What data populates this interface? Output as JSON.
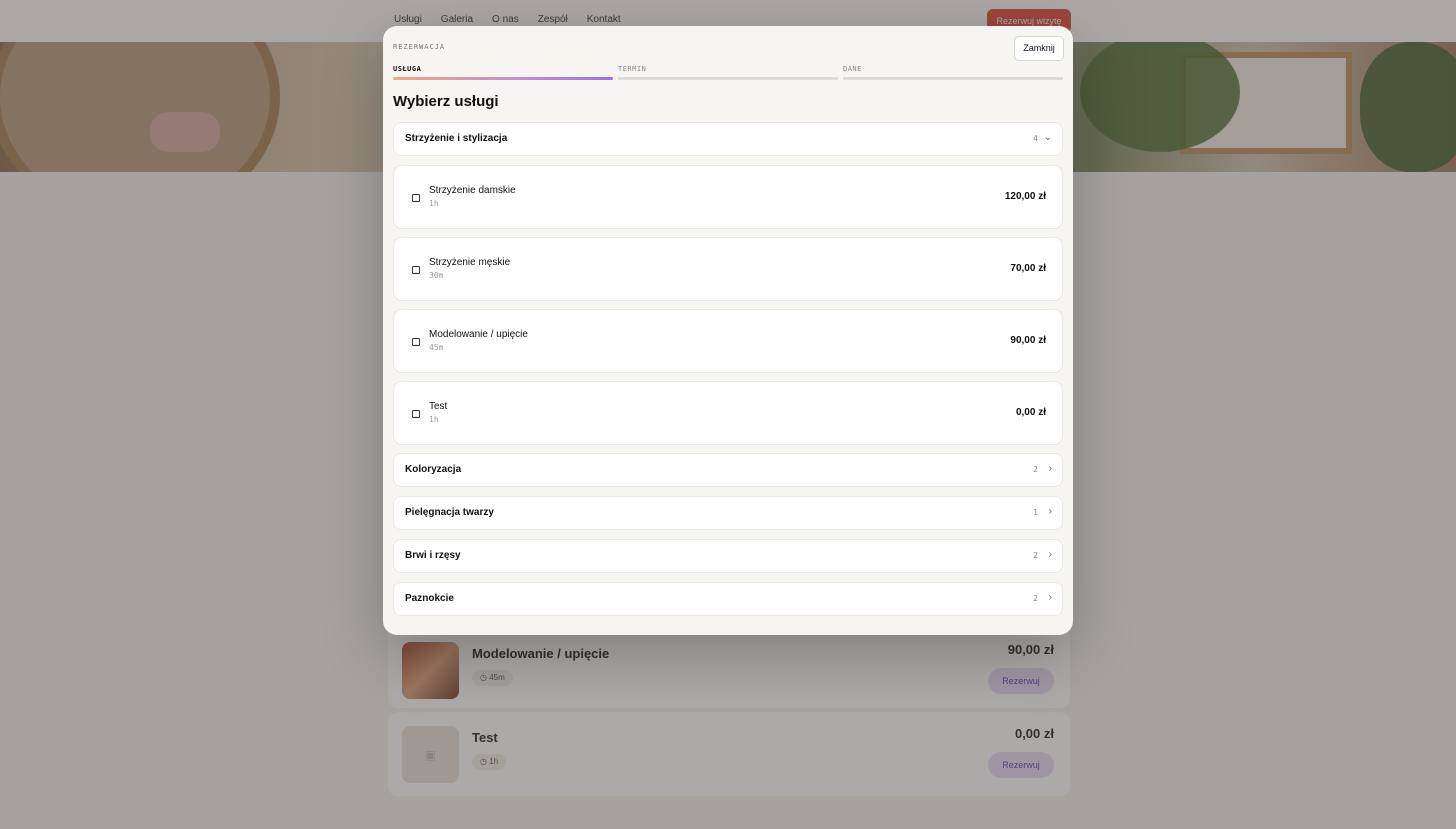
{
  "nav": {
    "links": [
      "Usługi",
      "Galeria",
      "O nas",
      "Zespół",
      "Kontakt"
    ],
    "cta": "Rezerwuj wizytę"
  },
  "background_cards": [
    {
      "title": "Modelowanie / upięcie",
      "duration": "45m",
      "price": "90,00 zł",
      "button": "Rezerwuj"
    },
    {
      "title": "Test",
      "duration": "1h",
      "price": "0,00 zł",
      "button": "Rezerwuj"
    }
  ],
  "modal": {
    "eyebrow": "REZERWACJA",
    "close_label": "Zamknij",
    "title": "Wybierz usługi",
    "steps": [
      {
        "label": "USŁUGA",
        "active": true
      },
      {
        "label": "TERMIN",
        "active": false
      },
      {
        "label": "DANE",
        "active": false
      }
    ],
    "open_category": {
      "name": "Strzyżenie i stylizacja",
      "count": "4",
      "chevron": "chevron-down-icon"
    },
    "services": [
      {
        "name": "Strzyżenie damskie",
        "duration": "1h",
        "price": "120,00 zł",
        "checked": false
      },
      {
        "name": "Strzyżenie męskie",
        "duration": "30m",
        "price": "70,00 zł",
        "checked": false
      },
      {
        "name": "Modelowanie / upięcie",
        "duration": "45m",
        "price": "90,00 zł",
        "checked": false
      },
      {
        "name": "Test",
        "duration": "1h",
        "price": "0,00 zł",
        "checked": false
      }
    ],
    "categories": [
      {
        "name": "Koloryzacja",
        "count": "2",
        "chevron": "chevron-right-icon"
      },
      {
        "name": "Pielęgnacja twarzy",
        "count": "1",
        "chevron": "chevron-right-icon"
      },
      {
        "name": "Brwi i rzęsy",
        "count": "2",
        "chevron": "chevron-right-icon"
      },
      {
        "name": "Paznokcie",
        "count": "2",
        "chevron": "chevron-right-icon"
      }
    ]
  },
  "colors": {
    "accent_start": "#f0a87c",
    "accent_end": "#9d6ef0",
    "cta": "#e0473d"
  }
}
